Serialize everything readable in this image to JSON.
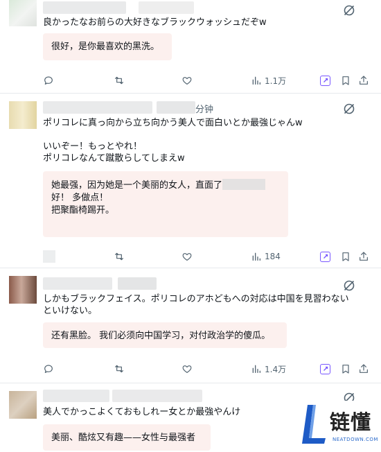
{
  "colors": {
    "accent": "#7856ff",
    "text": "#0f1419",
    "muted": "#536471",
    "translation_bg": "#fcf0ee",
    "watermark_blue": "#1e5bc6"
  },
  "tweets": [
    {
      "original": "良かったなお前らの大好きなブラックウォッシュだぞw",
      "translation": "很好，是你最喜欢的黑洗。",
      "counts": {
        "views": "1.1万"
      }
    },
    {
      "time_suffix": "分钟",
      "original": "ポリコレに真っ向から立ち向かう美人で面白いとか最強じゃんw\n\nいいぞー！もっとやれ！\nポリコレなんて蹴散らしてしまえw",
      "translation_line1": "她最强，因为她是一个美丽的女人，直面了",
      "translation_rest": "好！ 多做点！\n把聚酯椅踢开。",
      "counts": {
        "views": "184"
      }
    },
    {
      "original": "しかもブラックフェイス。ポリコレのアホどもへの対応は中国を見習わない\nといけない。",
      "translation": "还有黑脸。 我们必须向中国学习，对付政治学的傻瓜。",
      "counts": {
        "views": "1.4万"
      }
    },
    {
      "original": "美人でかっこよくておもしれー女とか最強やんけ",
      "translation": "美丽、酷炫又有趣——女性与最强者"
    }
  ],
  "icons": {
    "more": "slashed-circle-icon",
    "reply": "reply-icon",
    "retweet": "retweet-icon",
    "like": "heart-icon",
    "views": "views-chart-icon",
    "grok": "grok-icon",
    "bookmark": "bookmark-icon",
    "share": "share-icon"
  },
  "watermark": {
    "cn": "链懂",
    "en": "NEATDOWN.COM"
  }
}
